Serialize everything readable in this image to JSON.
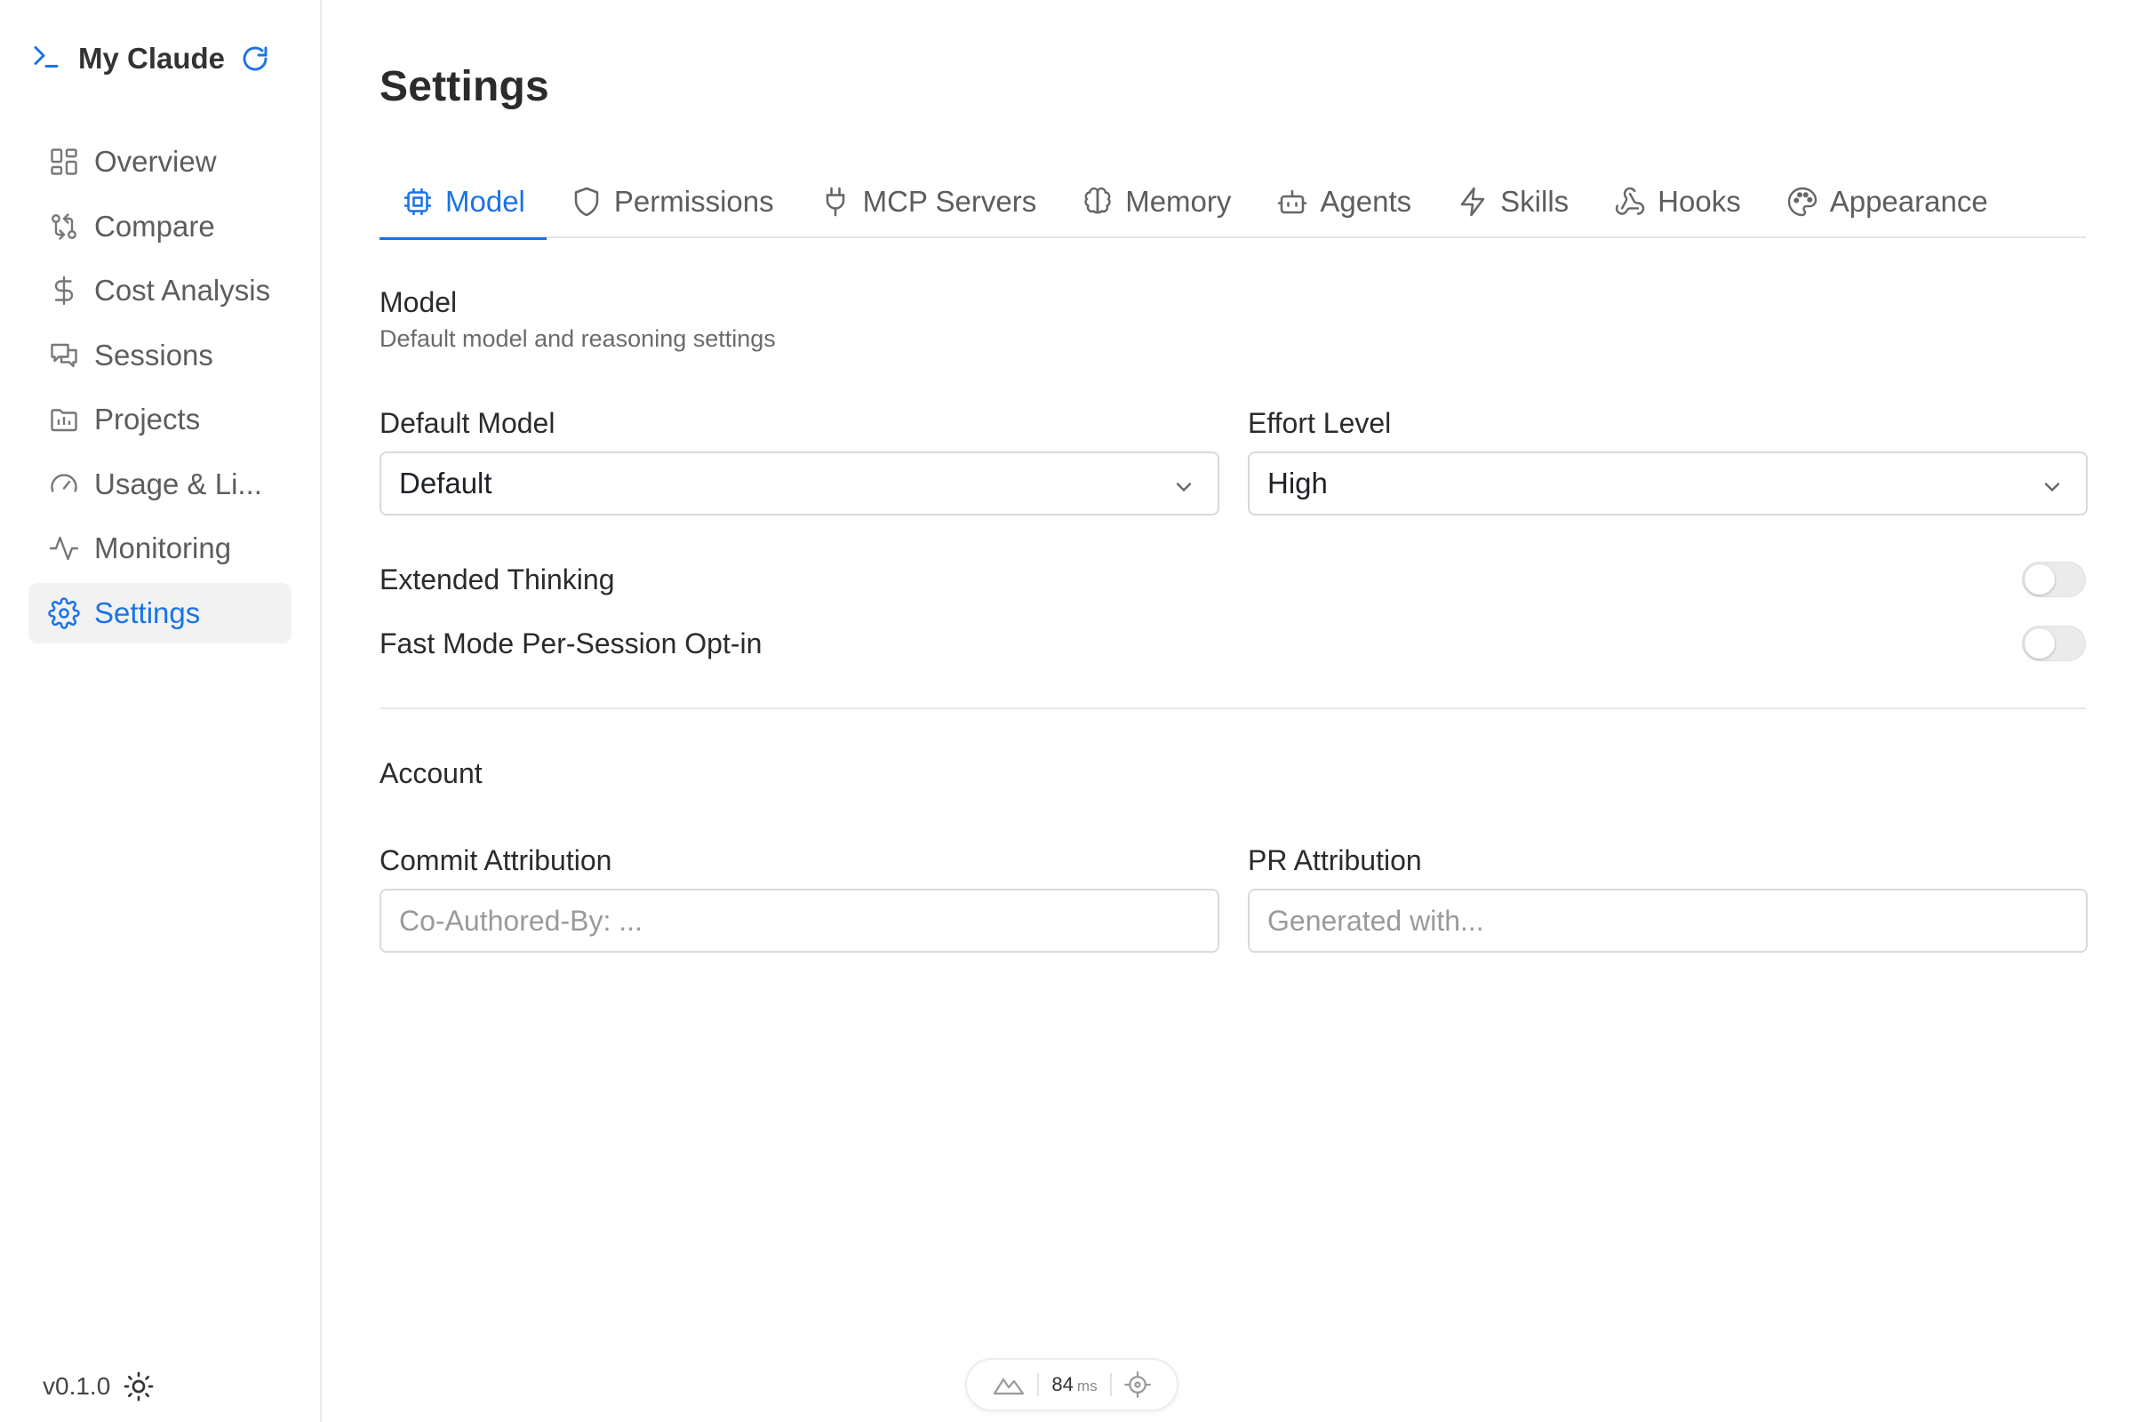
{
  "app": {
    "title": "My Claude",
    "version": "v0.1.0"
  },
  "sidebar": {
    "items": [
      {
        "label": "Overview",
        "icon": "grid-icon"
      },
      {
        "label": "Compare",
        "icon": "git-compare-icon"
      },
      {
        "label": "Cost Analysis",
        "icon": "dollar-icon"
      },
      {
        "label": "Sessions",
        "icon": "chat-icon"
      },
      {
        "label": "Projects",
        "icon": "folder-chart-icon"
      },
      {
        "label": "Usage & Li...",
        "icon": "gauge-icon"
      },
      {
        "label": "Monitoring",
        "icon": "activity-icon"
      },
      {
        "label": "Settings",
        "icon": "gear-icon",
        "active": true
      }
    ]
  },
  "main": {
    "title": "Settings",
    "tabs": [
      {
        "label": "Model",
        "icon": "cpu-icon",
        "active": true
      },
      {
        "label": "Permissions",
        "icon": "shield-icon"
      },
      {
        "label": "MCP Servers",
        "icon": "plug-icon"
      },
      {
        "label": "Memory",
        "icon": "brain-icon"
      },
      {
        "label": "Agents",
        "icon": "bot-icon"
      },
      {
        "label": "Skills",
        "icon": "bolt-icon"
      },
      {
        "label": "Hooks",
        "icon": "webhook-icon"
      },
      {
        "label": "Appearance",
        "icon": "palette-icon"
      }
    ],
    "model_section": {
      "title": "Model",
      "subtitle": "Default model and reasoning settings",
      "default_model_label": "Default Model",
      "default_model_value": "Default",
      "effort_label": "Effort Level",
      "effort_value": "High",
      "extended_thinking_label": "Extended Thinking",
      "extended_thinking_on": false,
      "fast_mode_label": "Fast Mode Per-Session Opt-in",
      "fast_mode_on": false
    },
    "account_section": {
      "title": "Account",
      "commit_label": "Commit Attribution",
      "commit_placeholder": "Co-Authored-By: ...",
      "pr_label": "PR Attribution",
      "pr_placeholder": "Generated with..."
    }
  },
  "perf": {
    "value": "84",
    "unit": "ms"
  },
  "colors": {
    "accent": "#1a73e8",
    "text": "#2b2b2b",
    "muted": "#6b6b6b",
    "border": "#d9d9d9"
  }
}
